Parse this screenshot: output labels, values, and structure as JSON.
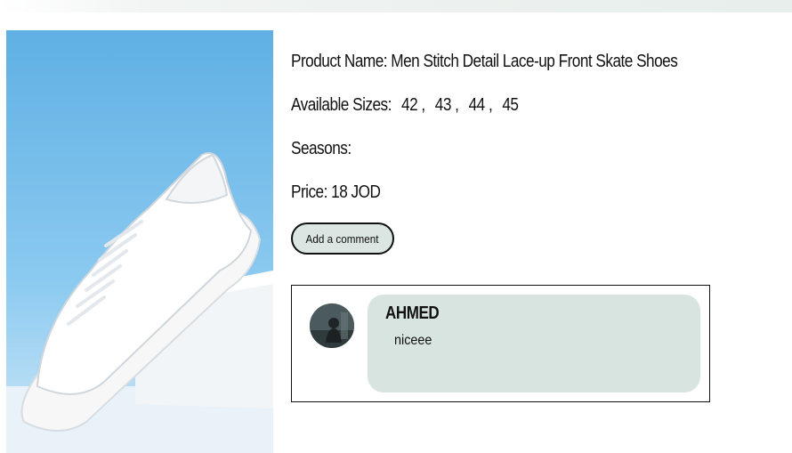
{
  "product": {
    "name_label": "Product Name:",
    "name": "Men Stitch Detail Lace-up Front Skate Shoes",
    "sizes_label": "Available Sizes:",
    "sizes": [
      "42 ,",
      "43 ,",
      "44 ,",
      "45"
    ],
    "seasons_label": "Seasons:",
    "price_label": "Price:",
    "price": "18 JOD",
    "image": "white-sneaker-on-blue-background"
  },
  "actions": {
    "add_comment_label": "Add a comment"
  },
  "comments": [
    {
      "author": "AHMED",
      "text": "niceee",
      "avatar": "user-avatar-photo"
    }
  ],
  "colors": {
    "image_bg": "#69b6e6",
    "button_bg": "#dbe6e2",
    "bubble_bg": "#d8e4e0"
  }
}
